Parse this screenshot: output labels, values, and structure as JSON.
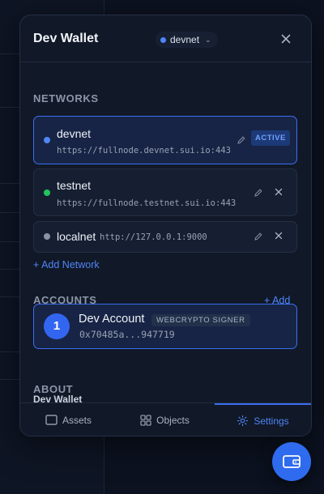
{
  "header": {
    "title": "Dev Wallet",
    "current_network": "devnet",
    "current_network_color": "#4f86f7"
  },
  "networks": {
    "section_title": "NETWORKS",
    "items": [
      {
        "name": "devnet",
        "url": "https://fullnode.devnet.sui.io:443",
        "color": "#4f86f7",
        "active": true,
        "badge": "ACTIVE"
      },
      {
        "name": "testnet",
        "url": "https://fullnode.testnet.sui.io:443",
        "color": "#22c55e",
        "active": false
      },
      {
        "name": "localnet",
        "url": "http://127.0.0.1:9000",
        "color": "#8a93a3",
        "active": false
      }
    ],
    "add_label": "+ Add Network"
  },
  "accounts": {
    "section_title": "ACCOUNTS",
    "add_label": "+ Add",
    "items": [
      {
        "index": "1",
        "name": "Dev Account",
        "signer": "WEBCRYPTO SIGNER",
        "address": "0x70485a...947719"
      }
    ]
  },
  "about": {
    "section_title": "ABOUT",
    "name": "Dev Wallet"
  },
  "tabs": [
    {
      "label": "Assets",
      "icon": "wallet-outline-icon",
      "active": false
    },
    {
      "label": "Objects",
      "icon": "grid-icon",
      "active": false
    },
    {
      "label": "Settings",
      "icon": "gear-icon",
      "active": true
    }
  ],
  "colors": {
    "accent": "#3b6ff0",
    "panel": "#111827",
    "background": "#0c1220"
  }
}
